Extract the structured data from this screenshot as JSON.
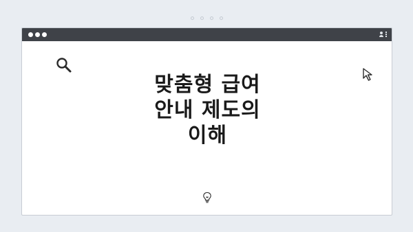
{
  "headline": {
    "line1": "맞춤형 급여",
    "line2": "안내 제도의",
    "line3": "이해"
  },
  "icons": {
    "search": "search-icon",
    "cursor": "cursor-arrow-icon",
    "bulb": "lightbulb-icon",
    "profile": "person-icon",
    "menu": "kebab-menu-icon"
  },
  "colors": {
    "background": "#e9edf2",
    "titlebar": "#3f4248",
    "text": "#1a1a1a"
  }
}
